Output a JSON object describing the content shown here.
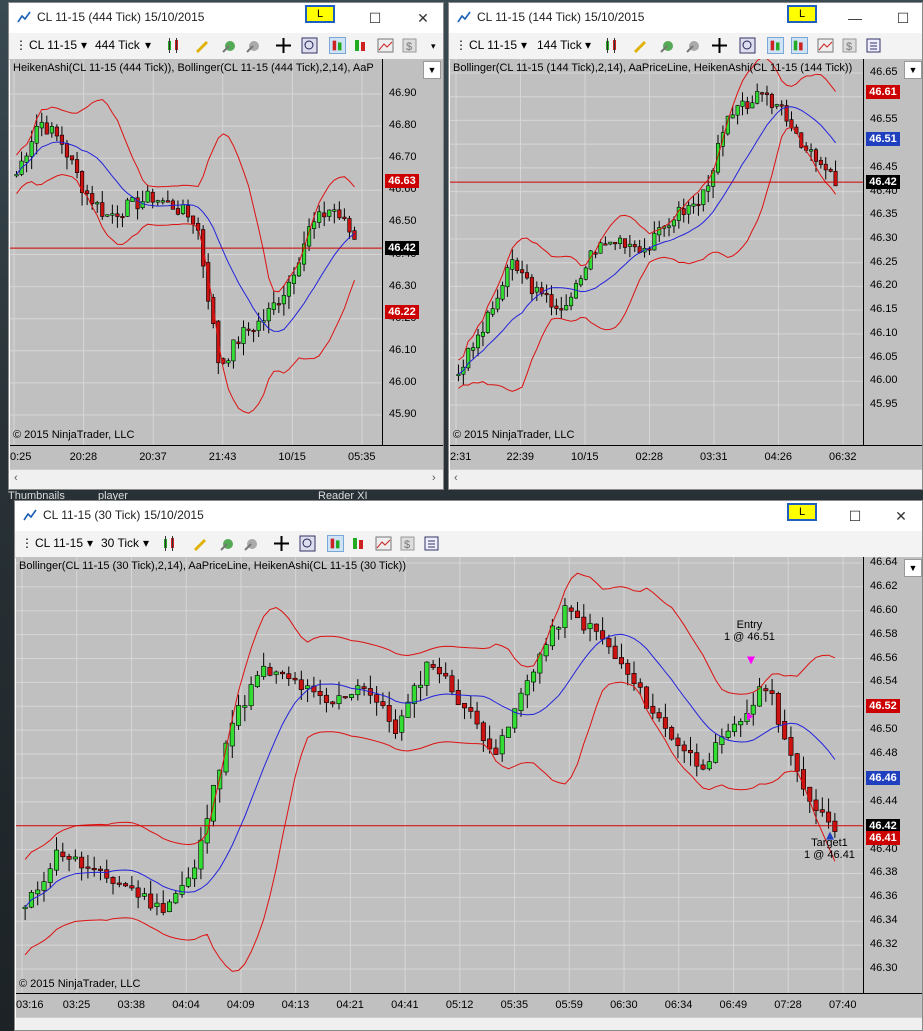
{
  "background": {
    "labels": [
      "Thumbnails",
      "player",
      "Reader XI"
    ]
  },
  "windows": [
    {
      "id": "w1",
      "title": "CL 11-15 (444 Tick)  15/10/2015",
      "link_label": "L",
      "instrument": "CL 11-15",
      "interval": "444 Tick",
      "indicator_label": "HeikenAshi(CL 11-15 (444 Tick)), Bollinger(CL 11-15 (444 Tick),2,14), AaP",
      "copyright": "© 2015 NinjaTrader, LLC",
      "y_ticks": [
        "46.90",
        "46.80",
        "46.70",
        "46.60",
        "46.50",
        "46.40",
        "46.30",
        "46.20",
        "46.10",
        "46.00",
        "45.90"
      ],
      "x_ticks": [
        "0:25",
        "20:28",
        "20:37",
        "21:43",
        "10/15",
        "05:35"
      ],
      "price_tags": [
        {
          "value": "46.63",
          "color": "#cc0000"
        },
        {
          "value": "46.42",
          "color": "#000000"
        },
        {
          "value": "46.22",
          "color": "#cc0000"
        }
      ],
      "price_line": 46.42
    },
    {
      "id": "w2",
      "title": "CL 11-15 (144 Tick)  15/10/2015",
      "link_label": "L",
      "instrument": "CL 11-15",
      "interval": "144 Tick",
      "indicator_label": "Bollinger(CL 11-15 (144 Tick),2,14), AaPriceLine, HeikenAshi(CL 11-15 (144 Tick))",
      "copyright": "© 2015 NinjaTrader, LLC",
      "y_ticks": [
        "46.65",
        "46.60",
        "46.55",
        "46.50",
        "46.45",
        "46.40",
        "46.35",
        "46.30",
        "46.25",
        "46.20",
        "46.15",
        "46.10",
        "46.05",
        "46.00",
        "45.95"
      ],
      "x_ticks": [
        "2:31",
        "22:39",
        "10/15",
        "02:28",
        "03:31",
        "04:26",
        "06:32"
      ],
      "price_tags": [
        {
          "value": "46.61",
          "color": "#cc0000"
        },
        {
          "value": "46.51",
          "color": "#1f3fbf"
        },
        {
          "value": "46.42",
          "color": "#000000"
        }
      ],
      "price_line": 46.42
    },
    {
      "id": "w3",
      "title": "CL 11-15 (30 Tick)  15/10/2015",
      "link_label": "L",
      "instrument": "CL 11-15",
      "interval": "30 Tick",
      "indicator_label": "Bollinger(CL 11-15 (30 Tick),2,14), AaPriceLine, HeikenAshi(CL 11-15 (30 Tick))",
      "copyright": "© 2015 NinjaTrader, LLC",
      "y_ticks": [
        "46.64",
        "46.62",
        "46.60",
        "46.58",
        "46.56",
        "46.54",
        "46.52",
        "46.50",
        "46.48",
        "46.46",
        "46.44",
        "46.42",
        "46.40",
        "46.38",
        "46.36",
        "46.34",
        "46.32",
        "46.30"
      ],
      "x_ticks": [
        "03:16",
        "03:25",
        "03:38",
        "04:04",
        "04:09",
        "04:13",
        "04:21",
        "04:41",
        "05:12",
        "05:35",
        "05:59",
        "06:30",
        "06:34",
        "06:49",
        "07:28",
        "07:40"
      ],
      "price_tags": [
        {
          "value": "46.52",
          "color": "#cc0000"
        },
        {
          "value": "46.46",
          "color": "#1f3fbf"
        },
        {
          "value": "46.42",
          "color": "#000000"
        },
        {
          "value": "46.41",
          "color": "#cc0000"
        }
      ],
      "price_line": 46.42,
      "entry_annotation": {
        "title": "Entry",
        "detail": "1 @ 46.51"
      },
      "target_annotation": {
        "title": "Target1",
        "detail": "1 @ 46.41"
      }
    }
  ],
  "colors": {
    "chart_bg": "#c0c0c0",
    "bull": "#33dd33",
    "bear": "#cc1111",
    "bollinger_band": "#dd1111",
    "bollinger_mid": "#2222dd",
    "price_line": "#cc0000",
    "link_button": "#ffff00"
  }
}
